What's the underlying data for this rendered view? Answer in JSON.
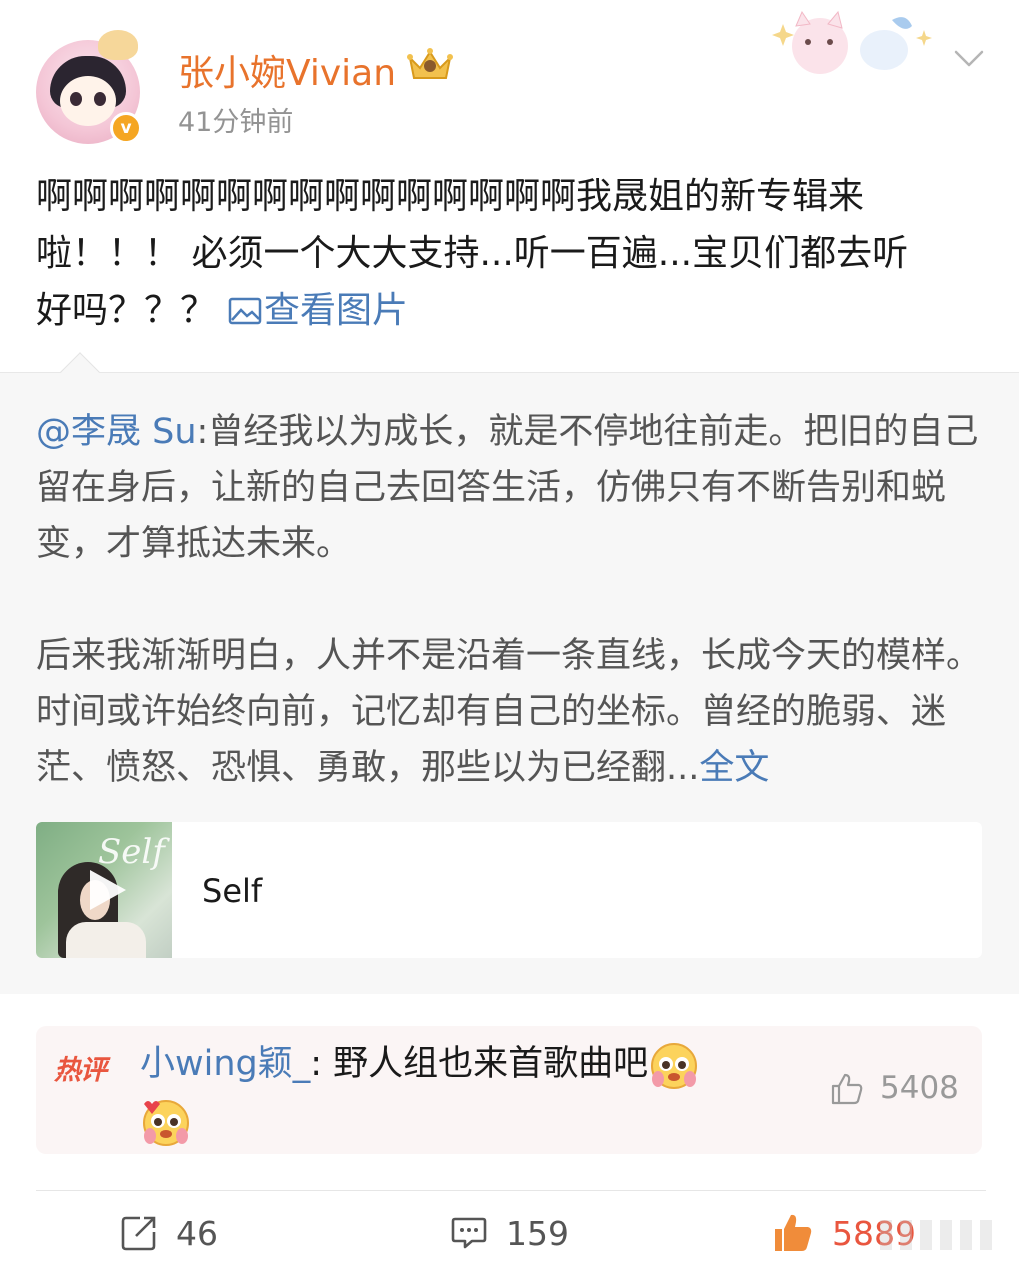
{
  "post": {
    "username": "张小婉Vivian",
    "time": "41分钟前",
    "text_line1": "啊啊啊啊啊啊啊啊啊啊啊啊啊啊啊我晟姐的新专辑来",
    "text_line2": "啦！！！ 必须一个大大支持...听一百遍...宝贝们都去听",
    "text_line3": "好吗？？？",
    "view_pic_label": "查看图片"
  },
  "repost": {
    "mention": "@李晟 Su",
    "para1_rest": ":曾经我以为成长，就是不停地往前走。把旧的自己留在身后，让新的自己去回答生活，仿佛只有不断告别和蜕变，才算抵达未来。",
    "para2": "后来我渐渐明白，人并不是沿着一条直线，长成今天的模样。时间或许始终向前，记忆却有自己的坐标。曾经的脆弱、迷茫、愤怒、恐惧、勇敢，那些以为已经翻...",
    "full_text_link": "全文",
    "music": {
      "cover_script": "Self",
      "title": "Self"
    }
  },
  "hot_comment": {
    "badge": "热评",
    "commenter": "小wing颖_",
    "text": ": 野人组也来首歌曲吧",
    "like_count": "5408"
  },
  "actions": {
    "repost_count": "46",
    "comment_count": "159",
    "like_count": "5889"
  },
  "icons": {
    "avatar": "avatar-image",
    "verified": "verified-badge-icon",
    "crown": "crown-icon",
    "more": "chevron-down-icon",
    "picture": "picture-icon",
    "play": "play-icon",
    "thumb": "thumbs-up-icon",
    "repost": "repost-icon",
    "comment": "comment-icon"
  },
  "colors": {
    "username": "#e8732c",
    "link": "#4a7bb7",
    "hot_badge": "#e9563f",
    "liked": "#e9563f",
    "verified": "#f5a623",
    "panel_bg": "#f7f7f7"
  }
}
